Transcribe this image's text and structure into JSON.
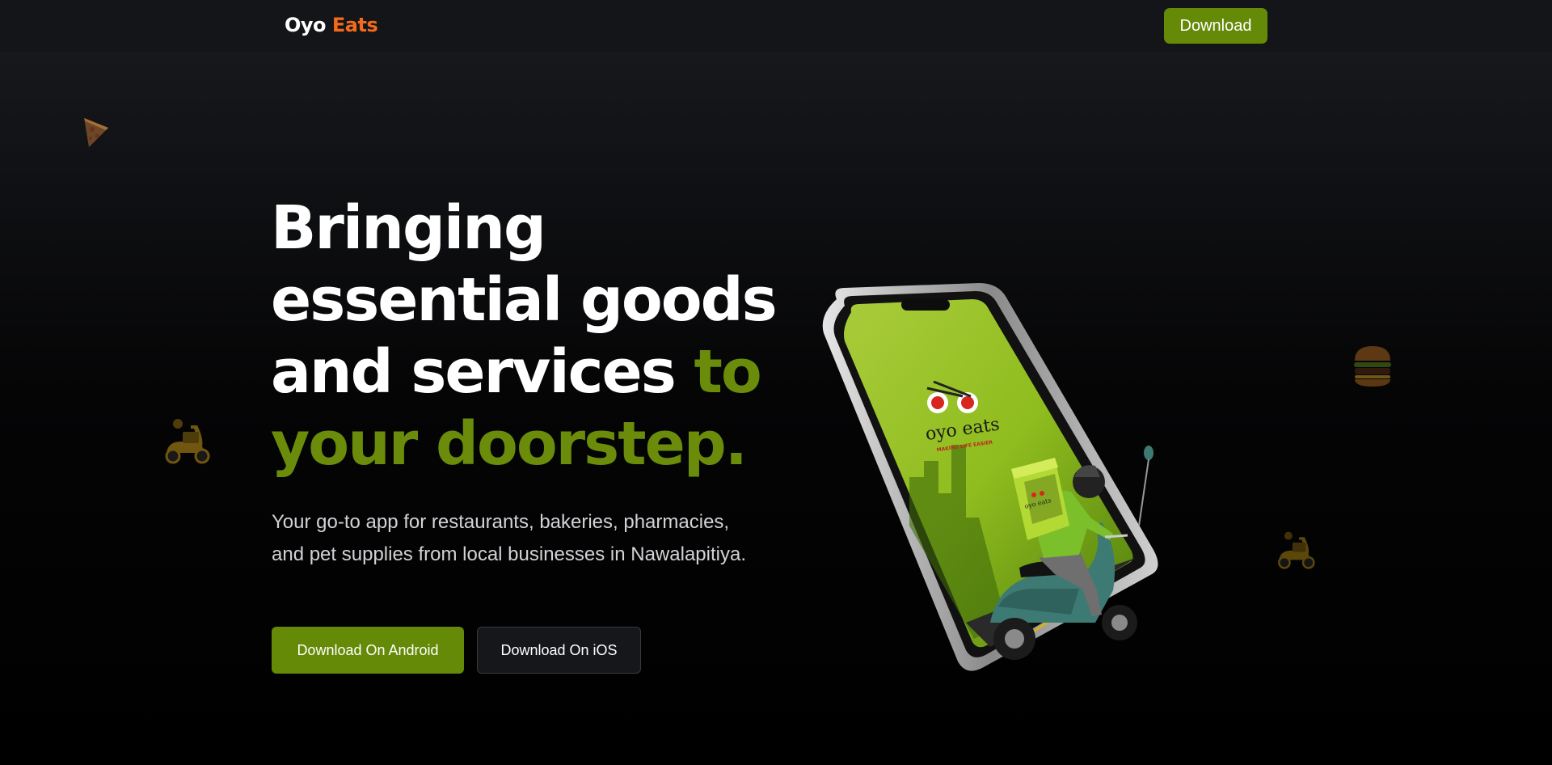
{
  "navbar": {
    "logo_word1": "Oyo",
    "logo_word2": "Eats",
    "download_label": "Download"
  },
  "hero": {
    "headline_line1": "Bringing",
    "headline_line2": "essential goods",
    "headline_line3_white": "and services ",
    "headline_line3_accent": "to",
    "headline_line4_accent": "your doorstep.",
    "subtext": "Your go-to app for restaurants, bakeries, pharmacies, and pet supplies from local businesses in Nawalapitiya.",
    "android_button": "Download On Android",
    "ios_button": "Download On iOS"
  },
  "illustration": {
    "app_logo_text": "oyo eats",
    "app_tagline": "MAKING LIFE EASIER",
    "bag_text": "oyo eats"
  },
  "colors": {
    "accent_green": "#648a08",
    "logo_orange": "#f26a1b",
    "background": "#000000"
  },
  "icons": [
    "pizza-slice-icon",
    "scooter-icon",
    "burger-icon",
    "scooter-icon"
  ]
}
